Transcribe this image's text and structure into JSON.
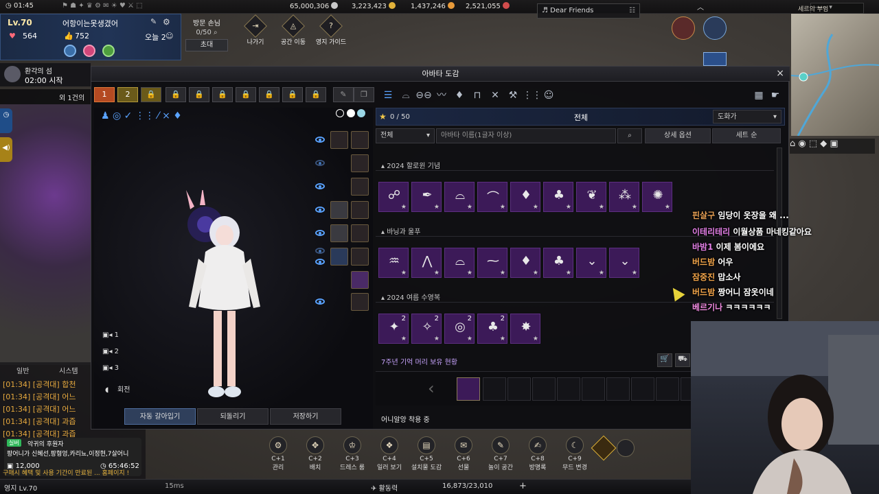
{
  "topbar": {
    "time": "01:45",
    "currency1": "65,000,306",
    "currency2": "3,223,423",
    "currency3": "1,437,246",
    "currency4": "2,521,055"
  },
  "character": {
    "level": "Lv.70",
    "name": "어항이는못생겼어",
    "stat1": "564",
    "stat2": "752",
    "today_label": "오늘 2"
  },
  "visitor": {
    "title": "방문 손님",
    "count": "0/50",
    "invite": "초대"
  },
  "hud_buttons": [
    {
      "icon": "⇥",
      "label": "나가기"
    },
    {
      "icon": "◬",
      "label": "공간 이동"
    },
    {
      "icon": "?",
      "label": "영지 가이드"
    }
  ],
  "music": {
    "title": "Dear Friends"
  },
  "minimap": {
    "zone": "세르의 부임"
  },
  "event": {
    "name": "환각의 섬",
    "time": "02:00 시작"
  },
  "quest_line": "외 1건의 스",
  "chat": {
    "tabs": [
      "일반",
      "시스템"
    ],
    "lines": [
      "[01:34] [공격대] 합천",
      "[01:34] [공격대] 어느",
      "[01:34] [공격대] 어느",
      "[01:34] [공격대] 과즙",
      "[01:34] [공격대] 과즙"
    ]
  },
  "notice": {
    "badge": "실버",
    "title": "악귀의 후원자",
    "names": "팡어니가 신혜선,팡형엉,카리뇨,이정현,7살어니",
    "amount": "12,000",
    "timer": "65:46:52",
    "footer": "구매시 혜택 및 사용 기간이 만료된 ... 홈페이지 !"
  },
  "window": {
    "title": "아바타 도감",
    "close": "×",
    "slot_tabs": [
      "1",
      "2"
    ],
    "category_title": "전체",
    "star_count": "0 / 50",
    "sort_select": "도화가",
    "filter_select": "전체",
    "search_placeholder": "아바타 이름(1글자 이상)",
    "detail_button": "상세 옵션",
    "set_button": "세트 순",
    "sections": [
      {
        "title": "2024 할로윈 기념",
        "items": [
          "☍",
          "✒",
          "⌓",
          "⌒",
          "♦",
          "♣",
          "❦",
          "⁂",
          "✺"
        ]
      },
      {
        "title": "바닝과 울푸",
        "items": [
          "♒",
          "⋀",
          "⌓",
          "⁓",
          "♦",
          "♣",
          "⌄",
          "⌄"
        ]
      },
      {
        "title": "2024 여름 수영복",
        "items": [
          "✦",
          "✧",
          "◎",
          "♣",
          "✸"
        ],
        "counts": [
          "2",
          "2",
          "2",
          "2",
          ""
        ]
      }
    ],
    "memory_title": "7주년 기억 머리 보유 현황",
    "wearing_label": "어니알앙 착용 중",
    "bottom_buttons": [
      "자동 갈아입기",
      "되돌리기",
      "저장하기"
    ],
    "cameras": [
      "1",
      "2",
      "3"
    ],
    "rotate_label": "회전"
  },
  "stream_chat": [
    {
      "name": "핀살구",
      "msg": "임당이 옷장을 왜 ...",
      "name_color": "#e8a054"
    },
    {
      "name": "이테리테리",
      "msg": "이월상품 마네킹같아요",
      "name_color": "#e37fe6"
    },
    {
      "name": "바밤1",
      "msg": "이제 봄이에요",
      "name_color": "#e37fe6"
    },
    {
      "name": "버드밤",
      "msg": "어우",
      "name_color": "#f2a44a"
    },
    {
      "name": "잠중진",
      "msg": "맙소사",
      "name_color": "#f2a44a"
    },
    {
      "name": "버드밤",
      "msg": "짱어니 잠옷이네",
      "name_color": "#f2a44a"
    },
    {
      "name": "베르기나",
      "msg": "ㅋㅋㅋㅋㅋㅋ",
      "name_color": "#f08ae0"
    }
  ],
  "hotbar": [
    {
      "key": "C+1",
      "label": "관리",
      "icon": "⚙"
    },
    {
      "key": "C+2",
      "label": "배치",
      "icon": "✥"
    },
    {
      "key": "C+3",
      "label": "드레스 룸",
      "icon": "♔"
    },
    {
      "key": "C+4",
      "label": "일러 보기",
      "icon": "❖"
    },
    {
      "key": "C+5",
      "label": "설치물 도감",
      "icon": "▤"
    },
    {
      "key": "C+6",
      "label": "선물",
      "icon": "✉"
    },
    {
      "key": "C+7",
      "label": "놀이 공간",
      "icon": "✎"
    },
    {
      "key": "C+8",
      "label": "방명록",
      "icon": "✍"
    },
    {
      "key": "C+9",
      "label": "무드 변경",
      "icon": "☾"
    }
  ],
  "bottom": {
    "zone_level": "영지 Lv.70",
    "ping": "15ms",
    "activity_label": "활동력",
    "activity_value": "16,873/23,010"
  }
}
